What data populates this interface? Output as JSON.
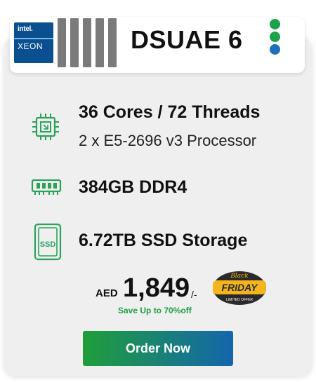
{
  "header": {
    "processor_brand": "intel.",
    "processor_line": "XEON",
    "title": "DSUAE 6",
    "status_dots": [
      {
        "name": "status-dot-green-1",
        "color": "#1aa34a"
      },
      {
        "name": "status-dot-green-2",
        "color": "#1aa34a"
      },
      {
        "name": "status-dot-blue",
        "color": "#1f6fb8"
      }
    ]
  },
  "specs": {
    "cpu": {
      "main": "36 Cores / 72 Threads",
      "sub": "2 x E5-2696 v3 Processor",
      "icon": "cpu-chip-icon"
    },
    "ram": {
      "main": "384GB DDR4",
      "icon": "ram-module-icon"
    },
    "storage": {
      "main": "6.72TB SSD Storage",
      "icon_label": "SSD",
      "icon": "ssd-drive-icon"
    }
  },
  "pricing": {
    "currency": "AED",
    "amount": "1,849",
    "suffix": "/-",
    "savings": "Save Up to 70%off"
  },
  "promo_badge": {
    "top": "Black",
    "main": "FRIDAY",
    "bottom": "LIMITED OFFER"
  },
  "cta": {
    "label": "Order Now"
  },
  "colors": {
    "accent_green": "#1f9e3a",
    "accent_blue": "#1466ad",
    "savings_green": "#1e9e45",
    "badge_gold": "#f4b51c"
  }
}
